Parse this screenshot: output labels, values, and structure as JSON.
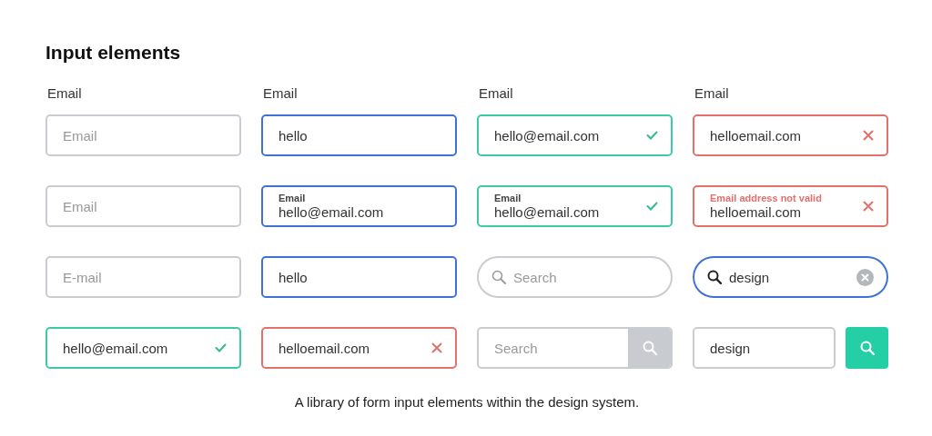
{
  "title": "Input elements",
  "labels": [
    "Email",
    "Email",
    "Email",
    "Email"
  ],
  "fields": [
    {
      "kind": "text",
      "color": "#c9cdd1",
      "checked": false,
      "invalid": false,
      "placeholder": "Email"
    },
    {
      "kind": "text",
      "color": "#3f72d6",
      "checked": false,
      "invalid": false,
      "value": "hello"
    },
    {
      "kind": "text",
      "color": "#3ccaa8",
      "checked": true,
      "invalid": false,
      "value": "hello@email.com"
    },
    {
      "kind": "text",
      "color": "#e2706c",
      "checked": false,
      "invalid": true,
      "value": "helloemail.com"
    },
    {
      "kind": "text",
      "color": "#c9cdd1",
      "checked": false,
      "invalid": false,
      "placeholder": "Email"
    },
    {
      "kind": "floating",
      "color": "#3f72d6",
      "checked": false,
      "invalid": false,
      "label": "Email",
      "value": "hello@email.com"
    },
    {
      "kind": "floating",
      "color": "#3ccaa8",
      "checked": true,
      "invalid": false,
      "label": "Email",
      "value": "hello@email.com"
    },
    {
      "kind": "floating",
      "color": "#e2706c",
      "checked": false,
      "invalid": true,
      "label": "Email address not valid",
      "value": "helloemail.com"
    },
    {
      "kind": "text",
      "color": "#c9cdd1",
      "checked": false,
      "invalid": false,
      "placeholder": "E-mail"
    },
    {
      "kind": "text",
      "color": "#3f72d6",
      "checked": false,
      "invalid": false,
      "value": "hello"
    },
    {
      "kind": "pill",
      "color": "#c9cdd1",
      "placeholder": "Search"
    },
    {
      "kind": "pill",
      "color": "#3f72d6",
      "value": "design",
      "clear_button": true
    },
    {
      "kind": "text",
      "color": "#3ccaa8",
      "checked": true,
      "invalid": false,
      "value": "hello@email.com"
    },
    {
      "kind": "text",
      "color": "#e2706c",
      "checked": false,
      "invalid": true,
      "value": "helloemail.com"
    },
    {
      "kind": "attached",
      "color": "#c9cdd1",
      "placeholder": "Search"
    },
    {
      "kind": "split",
      "color": "#c9cdd1",
      "value": "design"
    }
  ],
  "caption": "A library of form input elements within the design system."
}
